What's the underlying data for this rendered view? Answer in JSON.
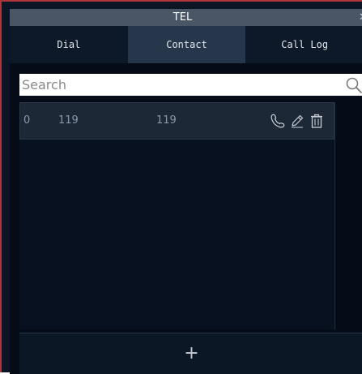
{
  "window": {
    "title": "TEL",
    "close_glyph": "✕"
  },
  "tabs": [
    {
      "label": "Dial",
      "active": false
    },
    {
      "label": "Contact",
      "active": true
    },
    {
      "label": "Call Log",
      "active": false
    }
  ],
  "search": {
    "value": "",
    "placeholder": "Search",
    "icon": "search-icon"
  },
  "contacts": [
    {
      "index": "0",
      "name": "119",
      "number": "119",
      "actions": [
        "phone-icon",
        "edit-icon",
        "trash-icon"
      ]
    }
  ],
  "footer": {
    "add_label": "+"
  },
  "colors": {
    "window_background": "#0b1524",
    "titlebar": "#4a5566",
    "active_tab": "#26374c",
    "row_background": "#1d2836",
    "row_text": "#8a97aa",
    "border_accent": "#b0343a"
  }
}
